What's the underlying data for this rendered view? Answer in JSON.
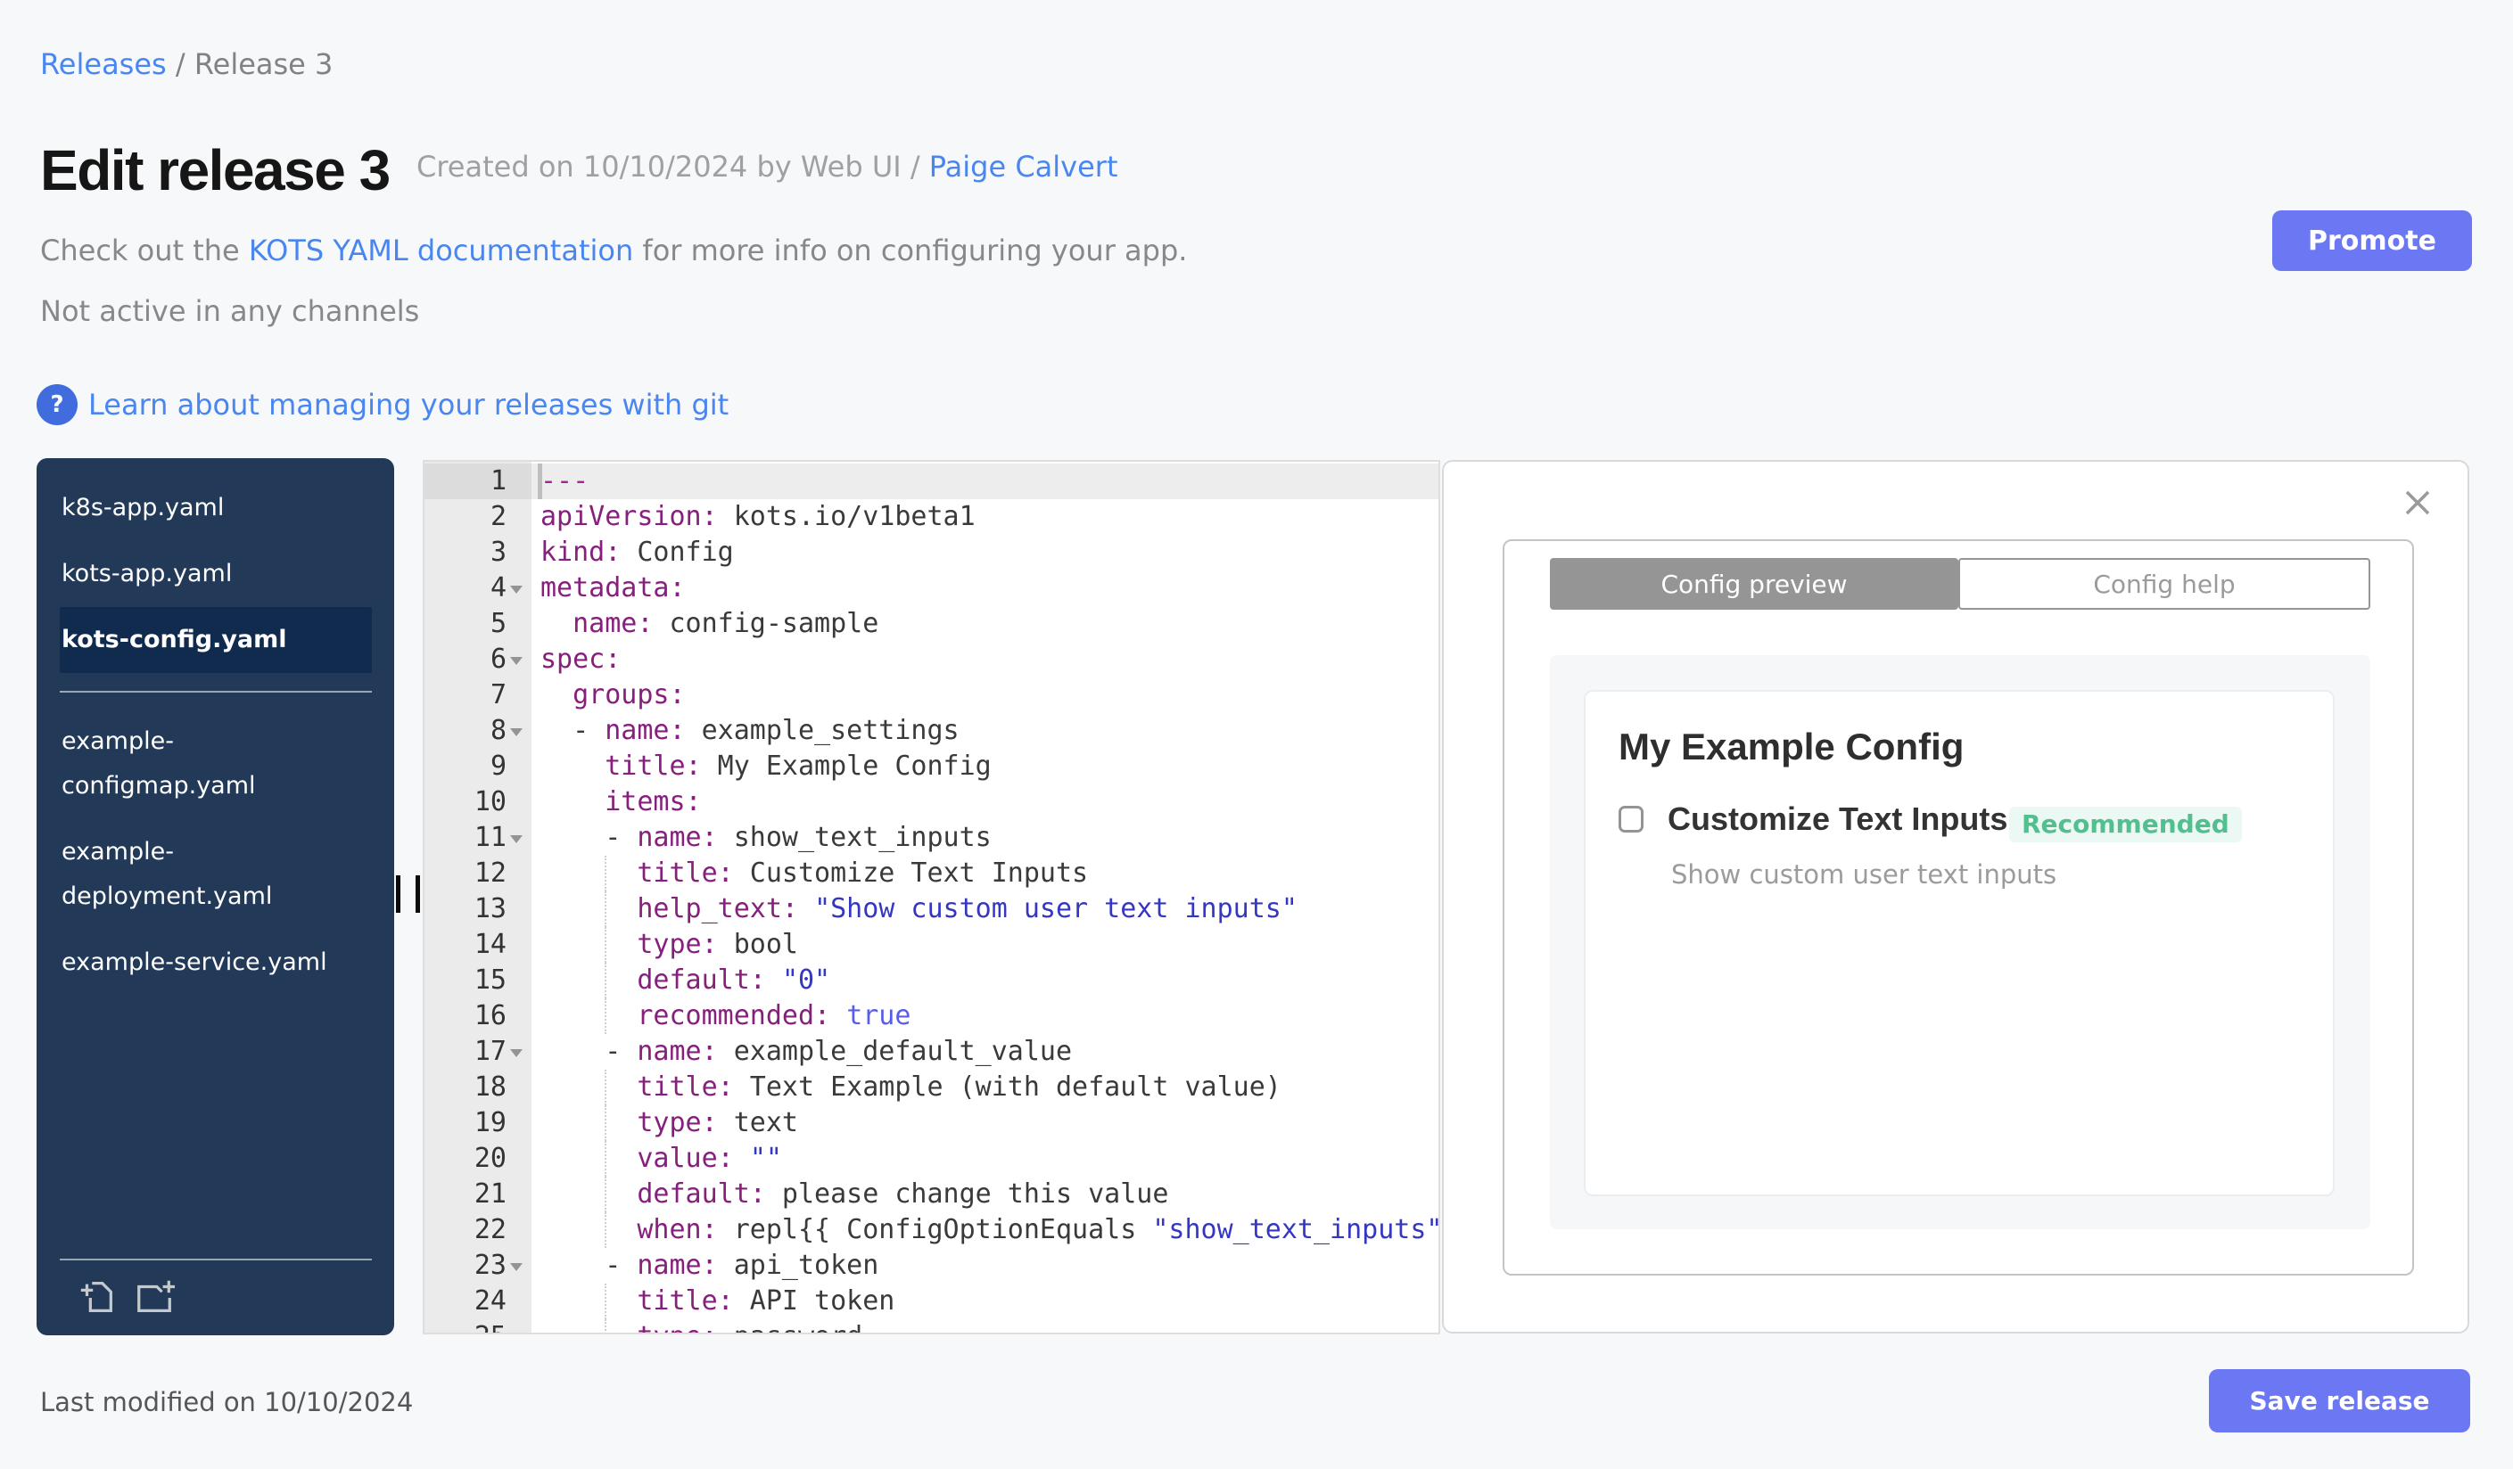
{
  "breadcrumb": {
    "link": "Releases",
    "separator": " / ",
    "current": "Release 3"
  },
  "header": {
    "title": "Edit release 3",
    "created_prefix": "Created on 10/10/2024 by Web UI / ",
    "created_link": "Paige Calvert",
    "doc_pre": "Check out the ",
    "doc_link": "KOTS YAML documentation",
    "doc_post": " for more info on configuring your app.",
    "channels_status": "Not active in any channels",
    "question_icon": "?",
    "git_link": "Learn about managing your releases with git",
    "promote_label": "Promote"
  },
  "sidebar": {
    "files": [
      {
        "label": "k8s-app.yaml",
        "selected": false,
        "divider_before": false
      },
      {
        "label": "kots-app.yaml",
        "selected": false,
        "divider_before": false
      },
      {
        "label": "kots-config.yaml",
        "selected": true,
        "divider_before": false
      },
      {
        "label": "example-configmap.yaml",
        "selected": false,
        "divider_before": true
      },
      {
        "label": "example-deployment.yaml",
        "selected": false,
        "divider_before": false
      },
      {
        "label": "example-service.yaml",
        "selected": false,
        "divider_before": false
      }
    ],
    "icons": [
      "add-file-icon",
      "add-folder-icon"
    ]
  },
  "editor": {
    "active_line": 1,
    "fold_lines": [
      4,
      6,
      8,
      11,
      17,
      23
    ],
    "lines": [
      {
        "tokens": [
          [
            "m",
            "---"
          ]
        ]
      },
      {
        "tokens": [
          [
            "k",
            "apiVersion:"
          ],
          [
            "p",
            " kots.io/v1beta1"
          ]
        ]
      },
      {
        "tokens": [
          [
            "k",
            "kind:"
          ],
          [
            "p",
            " Config"
          ]
        ]
      },
      {
        "tokens": [
          [
            "k",
            "metadata:"
          ]
        ]
      },
      {
        "tokens": [
          [
            "p",
            "  "
          ],
          [
            "k",
            "name:"
          ],
          [
            "p",
            " config-sample"
          ]
        ]
      },
      {
        "tokens": [
          [
            "k",
            "spec:"
          ]
        ]
      },
      {
        "tokens": [
          [
            "p",
            "  "
          ],
          [
            "k",
            "groups:"
          ]
        ]
      },
      {
        "tokens": [
          [
            "p",
            "  - "
          ],
          [
            "k",
            "name:"
          ],
          [
            "p",
            " example_settings"
          ]
        ]
      },
      {
        "tokens": [
          [
            "p",
            "    "
          ],
          [
            "k",
            "title:"
          ],
          [
            "p",
            " My Example Config"
          ]
        ]
      },
      {
        "tokens": [
          [
            "p",
            "    "
          ],
          [
            "k",
            "items:"
          ]
        ]
      },
      {
        "tokens": [
          [
            "p",
            "    - "
          ],
          [
            "k",
            "name:"
          ],
          [
            "p",
            " show_text_inputs"
          ]
        ]
      },
      {
        "tokens": [
          [
            "p",
            "      "
          ],
          [
            "k",
            "title:"
          ],
          [
            "p",
            " Customize Text Inputs"
          ]
        ]
      },
      {
        "tokens": [
          [
            "p",
            "      "
          ],
          [
            "k",
            "help_text:"
          ],
          [
            "p",
            " "
          ],
          [
            "s",
            "\"Show custom user text inputs\""
          ]
        ]
      },
      {
        "tokens": [
          [
            "p",
            "      "
          ],
          [
            "k",
            "type:"
          ],
          [
            "p",
            " bool"
          ]
        ]
      },
      {
        "tokens": [
          [
            "p",
            "      "
          ],
          [
            "k",
            "default:"
          ],
          [
            "p",
            " "
          ],
          [
            "s",
            "\"0\""
          ]
        ]
      },
      {
        "tokens": [
          [
            "p",
            "      "
          ],
          [
            "k",
            "recommended:"
          ],
          [
            "p",
            " "
          ],
          [
            "b",
            "true"
          ]
        ]
      },
      {
        "tokens": [
          [
            "p",
            "    - "
          ],
          [
            "k",
            "name:"
          ],
          [
            "p",
            " example_default_value"
          ]
        ]
      },
      {
        "tokens": [
          [
            "p",
            "      "
          ],
          [
            "k",
            "title:"
          ],
          [
            "p",
            " Text Example (with default value)"
          ]
        ]
      },
      {
        "tokens": [
          [
            "p",
            "      "
          ],
          [
            "k",
            "type:"
          ],
          [
            "p",
            " text"
          ]
        ]
      },
      {
        "tokens": [
          [
            "p",
            "      "
          ],
          [
            "k",
            "value:"
          ],
          [
            "p",
            " "
          ],
          [
            "s",
            "\"\""
          ]
        ]
      },
      {
        "tokens": [
          [
            "p",
            "      "
          ],
          [
            "k",
            "default:"
          ],
          [
            "p",
            " please change this value"
          ]
        ]
      },
      {
        "tokens": [
          [
            "p",
            "      "
          ],
          [
            "k",
            "when:"
          ],
          [
            "p",
            " repl{{ ConfigOptionEquals "
          ],
          [
            "s",
            "\"show_text_inputs\""
          ]
        ]
      },
      {
        "tokens": [
          [
            "p",
            "    - "
          ],
          [
            "k",
            "name:"
          ],
          [
            "p",
            " api_token"
          ]
        ]
      },
      {
        "tokens": [
          [
            "p",
            "      "
          ],
          [
            "k",
            "title:"
          ],
          [
            "p",
            " API token"
          ]
        ]
      },
      {
        "tokens": [
          [
            "p",
            "      "
          ],
          [
            "k",
            "type:"
          ],
          [
            "p",
            " password"
          ]
        ]
      }
    ]
  },
  "panel": {
    "tabs": [
      {
        "label": "Config preview",
        "active": true
      },
      {
        "label": "Config help",
        "active": false
      }
    ],
    "preview": {
      "group_title": "My Example Config",
      "item_title": "Customize Text Inputs",
      "badge": "Recommended",
      "help_text": "Show custom user text inputs",
      "checkbox_checked": false
    }
  },
  "footer": {
    "last_modified": "Last modified on 10/10/2024",
    "save_label": "Save release"
  }
}
